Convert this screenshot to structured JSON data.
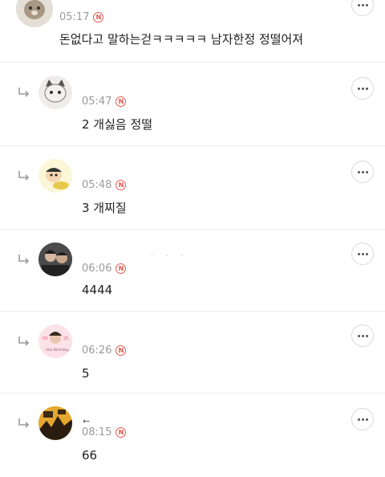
{
  "comments": [
    {
      "time": "05:17",
      "badge": "N",
      "text": "돈없다고 말하는걷ㅋㅋㅋㅋㅋ 남자한정 정떨어져"
    },
    {
      "time": "05:47",
      "badge": "N",
      "text": "2 개싫음 정떨"
    },
    {
      "time": "05:48",
      "badge": "N",
      "text": "3 개찌질"
    },
    {
      "time": "06:06",
      "badge": "N",
      "text": "4444",
      "extra": "· · ·"
    },
    {
      "time": "06:26",
      "badge": "N",
      "text": "5",
      "avatar_text": "03 25 Sho Birthday"
    },
    {
      "time": "08:15",
      "badge": "N",
      "text": "66",
      "nick": "←"
    }
  ],
  "icons": {
    "reply": "reply-arrow-icon",
    "more": "more-options-icon",
    "new": "new-badge-icon"
  },
  "colors": {
    "badge": "#e3584f",
    "time": "#9a9a9a",
    "divider": "#ececec"
  }
}
